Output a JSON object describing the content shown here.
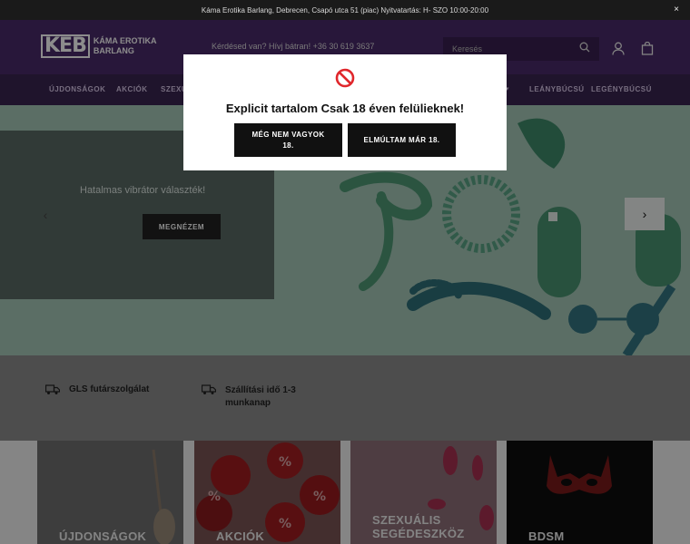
{
  "topbar": {
    "text": "Káma Erotika Barlang, Debrecen, Csapó utca 51 (piac) Nyitvatartás: H- SZO 10:00-20:00",
    "close": "×"
  },
  "header": {
    "logo_mark": "KEB",
    "logo_line1": "KÁMA EROTIKA",
    "logo_line2": "BARLANG",
    "contact": "Kérdésed van? Hívj bátran! +36 30 619 3637",
    "search_placeholder": "Keresés"
  },
  "nav": {
    "items": [
      "ÚJDONSÁGOK",
      "AKCIÓK",
      "SZEXU",
      "LEÁNYBÚCSÚ",
      "LEGÉNYBÚCSÚ"
    ]
  },
  "hero": {
    "text": "Hatalmas vibrátor választék!",
    "button": "MEGNÉZEM",
    "prev": "‹",
    "next": "›"
  },
  "features": [
    {
      "icon": "truck-icon",
      "text": "GLS futárszolgálat"
    },
    {
      "icon": "truck-icon",
      "line1": "Szállítási idő 1-3",
      "line2": "munkanap"
    }
  ],
  "categories": [
    {
      "label": "ÚJDONSÁGOK"
    },
    {
      "label": "AKCIÓK"
    },
    {
      "label_line1": "SZEXUÁLIS",
      "label_line2": "SEGÉDESZKÖZ"
    },
    {
      "label": "BDSM"
    }
  ],
  "modal": {
    "title": "Explicit tartalom Csak 18 éven felülieknek!",
    "decline_line1": "MÉG NEM VAGYOK",
    "decline_line2": "18.",
    "accept": "ELMÚLTAM MÁR 18."
  },
  "colors": {
    "header_bg": "#4a2a6a",
    "nav_bg": "#3a2550",
    "hero_bg": "#9fc2b2",
    "button_bg": "#111111",
    "ban_red": "#e0262b"
  }
}
